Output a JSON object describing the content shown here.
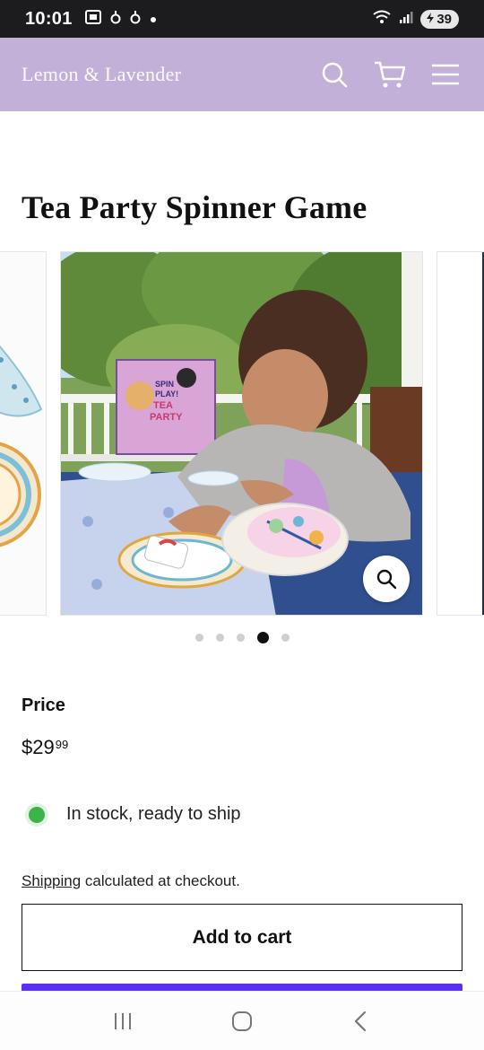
{
  "status_bar": {
    "time": "10:01",
    "battery": "39"
  },
  "header": {
    "brand": "Lemon & Lavender",
    "icons": [
      "search-icon",
      "cart-icon",
      "menu-icon"
    ],
    "background": "#c2b0d8"
  },
  "product": {
    "title": "Tea Party Spinner Game",
    "box_text": [
      "SPIN",
      "PLAY!",
      "TEA",
      "PARTY"
    ],
    "price_label": "Price",
    "price_main": "$29",
    "price_cents": "99",
    "stock_text": "In stock, ready to ship",
    "shipping_link": "Shipping",
    "shipping_text": " calculated at checkout.",
    "add_to_cart_label": "Add to cart"
  },
  "carousel": {
    "slide_count": 5,
    "active_index": 3
  },
  "colors": {
    "header": "#c2b0d8",
    "stock_dot": "#3db34a",
    "buy_button": "#5a31f4"
  }
}
